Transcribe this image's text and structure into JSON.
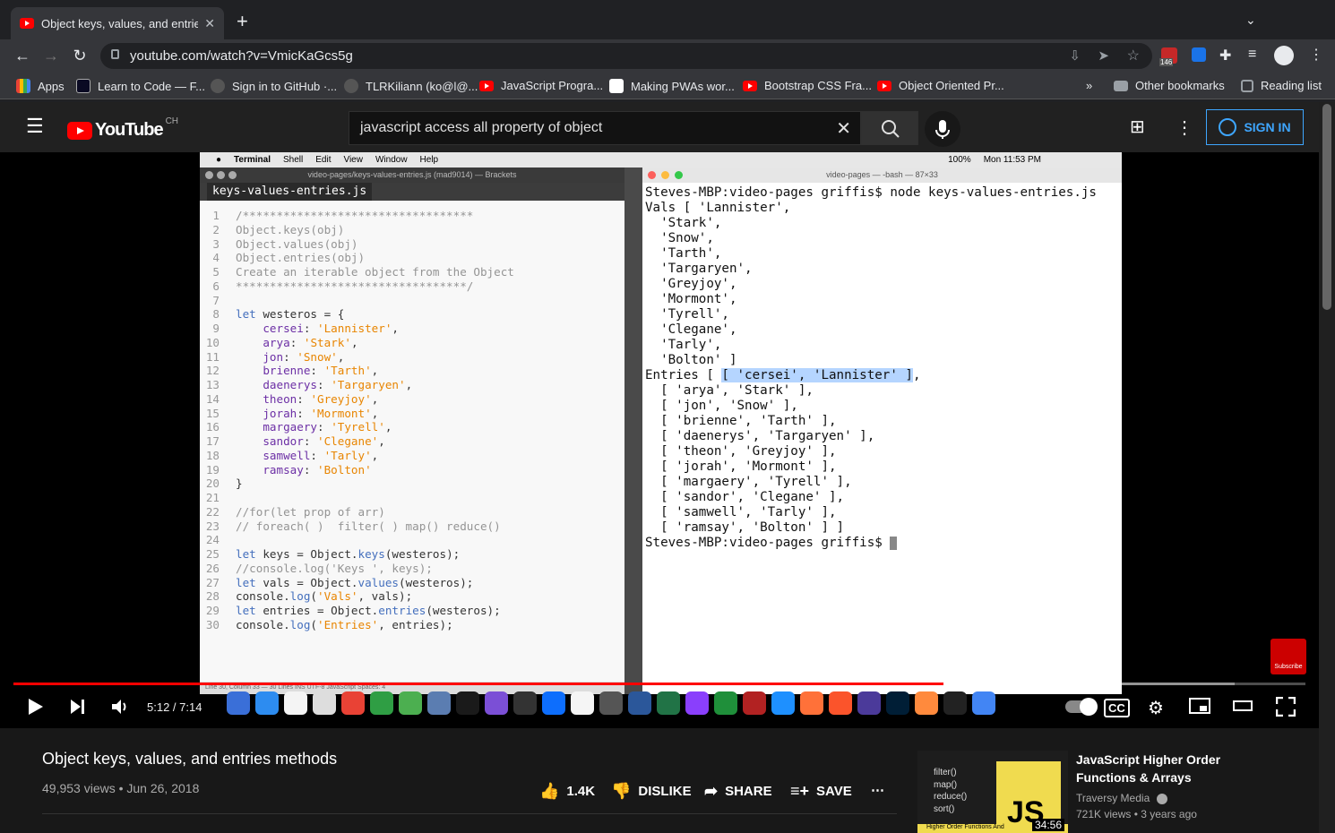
{
  "browser": {
    "tab_title": "Object keys, values, and entries methods",
    "tab_title_display": "Object keys, values, and entrie",
    "url": "youtube.com/watch?v=VmicKaGcs5g",
    "ext_badge": "146",
    "bookmarks": [
      {
        "label": "Apps",
        "color": "#ea4335"
      },
      {
        "label": "Learn to Code — F...",
        "color": "#0a0a23"
      },
      {
        "label": "Sign in to GitHub ·...",
        "color": "#24292e"
      },
      {
        "label": "TLRKiliann (ko@l@...",
        "color": "#24292e"
      },
      {
        "label": "JavaScript Progra...",
        "color": "#ff0000"
      },
      {
        "label": "Making PWAs wor...",
        "color": "#ffffff"
      },
      {
        "label": "Bootstrap CSS Fra...",
        "color": "#ff0000"
      },
      {
        "label": "Object Oriented Pr...",
        "color": "#ff0000"
      }
    ],
    "other_bookmarks": "Other bookmarks",
    "reading_list": "Reading list"
  },
  "youtube": {
    "logo": "YouTube",
    "country": "CH",
    "search_value": "javascript access all property of object",
    "sign_in": "SIGN IN"
  },
  "video": {
    "mac_menu": [
      "Terminal",
      "Shell",
      "Edit",
      "View",
      "Window",
      "Help"
    ],
    "mac_clock": "Mon 11:53 PM",
    "mac_battery": "100%",
    "editor_title": "video-pages/keys-values-entries.js (mad9014) — Brackets",
    "editor_tab": "keys-values-entries.js",
    "terminal_title": "video-pages — -bash — 87×33",
    "status_bar": "Line 30, Column 33 — 30 Lines     INS     UTF-8     JavaScript     Spaces: 4",
    "code_lines": [
      "/**********************************",
      "Object.keys(obj)",
      "Object.values(obj)",
      "Object.entries(obj)",
      "Create an iterable object from the Object",
      "**********************************/",
      "",
      "let westeros = {",
      "    cersei: 'Lannister',",
      "    arya: 'Stark',",
      "    jon: 'Snow',",
      "    brienne: 'Tarth',",
      "    daenerys: 'Targaryen',",
      "    theon: 'Greyjoy',",
      "    jorah: 'Mormont',",
      "    margaery: 'Tyrell',",
      "    sandor: 'Clegane',",
      "    samwell: 'Tarly',",
      "    ramsay: 'Bolton'",
      "}",
      "",
      "//for(let prop of arr)",
      "// foreach( )  filter( ) map() reduce()",
      "",
      "let keys = Object.keys(westeros);",
      "//console.log('Keys ', keys);",
      "let vals = Object.values(westeros);",
      "console.log('Vals', vals);",
      "let entries = Object.entries(westeros);",
      "console.log('Entries', entries);"
    ],
    "terminal_lines": [
      "Steves-MBP:video-pages griffis$ node keys-values-entries.js",
      "Vals [ 'Lannister',",
      "  'Stark',",
      "  'Snow',",
      "  'Tarth',",
      "  'Targaryen',",
      "  'Greyjoy',",
      "  'Mormont',",
      "  'Tyrell',",
      "  'Clegane',",
      "  'Tarly',",
      "  'Bolton' ]",
      "Entries [ [ 'cersei', 'Lannister' ],",
      "  [ 'arya', 'Stark' ],",
      "  [ 'jon', 'Snow' ],",
      "  [ 'brienne', 'Tarth' ],",
      "  [ 'daenerys', 'Targaryen' ],",
      "  [ 'theon', 'Greyjoy' ],",
      "  [ 'jorah', 'Mormont' ],",
      "  [ 'margaery', 'Tyrell' ],",
      "  [ 'sandor', 'Clegane' ],",
      "  [ 'samwell', 'Tarly' ],",
      "  [ 'ramsay', 'Bolton' ] ]",
      "Steves-MBP:video-pages griffis$ "
    ],
    "current_time": "5:12 / 7:14",
    "played_fraction": 0.72,
    "buffered_fraction": 0.945,
    "subscribe_label": "Subscribe",
    "accent": "#ff0000"
  },
  "info": {
    "title": "Object keys, values, and entries methods",
    "meta": "49,953 views • Jun 26, 2018",
    "likes": "1.4K",
    "dislike": "DISLIKE",
    "share": "SHARE",
    "save": "SAVE"
  },
  "related": {
    "title": "JavaScript Higher Order Functions & Arrays",
    "channel": "Traversy Media",
    "meta": "721K views • 3 years ago",
    "duration": "34:56",
    "thumb_lines": [
      "filter()",
      "map()",
      "reduce()",
      "sort()"
    ],
    "thumb_badge": "JS",
    "thumb_caption": "Higher Order Functions And"
  }
}
